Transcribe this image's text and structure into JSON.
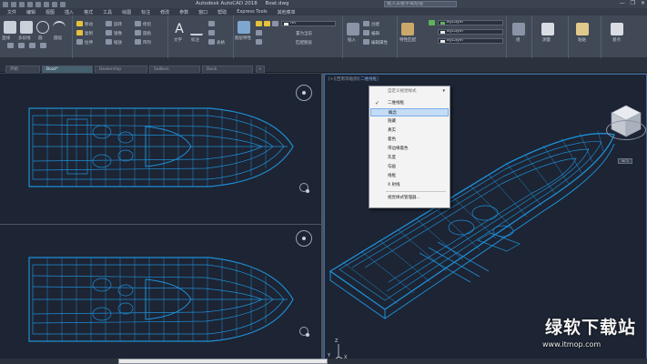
{
  "titlebar": {
    "app_title": "Autodesk AutoCAD 2018",
    "file_name": "Boat.dwg",
    "search_placeholder": "键入关键字或短语",
    "win_minimize": "—",
    "win_maximize": "❐",
    "win_close": "✕"
  },
  "menubar": [
    "文件",
    "编辑",
    "视图",
    "插入",
    "格式",
    "工具",
    "绘图",
    "标注",
    "修改",
    "参数",
    "窗口",
    "帮助",
    "Express Tools",
    "其他菜单"
  ],
  "ribbon": {
    "groups": [
      {
        "label": "绘图"
      },
      {
        "label": "修改"
      },
      {
        "label": "注释"
      },
      {
        "label": "图层"
      },
      {
        "label": "块"
      },
      {
        "label": "特性"
      },
      {
        "label": "组"
      },
      {
        "label": "实用工具"
      },
      {
        "label": "剪贴板"
      },
      {
        "label": "视图"
      }
    ],
    "tools": {
      "line": "直线",
      "polyline": "多段线",
      "circle": "圆",
      "arc": "圆弧",
      "move": "移动",
      "rotate": "旋转",
      "trim": "修剪",
      "copy": "复制",
      "mirror": "镜像",
      "fillet": "圆角",
      "stretch": "拉伸",
      "scale": "缩放",
      "array": "阵列",
      "text": "文字",
      "dimension": "标注",
      "table": "表格",
      "layer_properties": "图层特性",
      "make_current": "置为当前",
      "match_layer": "匹配图层",
      "insert": "插入",
      "create": "创建",
      "edit": "编辑",
      "edit_attributes": "编辑属性",
      "match_properties": "特性匹配",
      "group": "组",
      "measure": "测量",
      "paste": "粘贴",
      "base": "基点"
    },
    "layer_combo": "AR",
    "color_combo": "ByLayer",
    "linetype_combo": "ByLayer",
    "lineweight_combo": "ByLayer"
  },
  "doc_tabs": [
    "开始",
    "Boat*",
    "Dealership",
    "Sallbon",
    "Dock"
  ],
  "viewports": {
    "right_label_prefix": "[+][西南等轴测][",
    "right_label_style": "二维线框",
    "right_label_suffix": "]"
  },
  "context_menu": {
    "header": "自定义视觉样式",
    "items": [
      {
        "label": "二维线框",
        "checked": true
      },
      {
        "label": "概念",
        "highlighted": true
      },
      {
        "label": "隐藏"
      },
      {
        "label": "真实"
      },
      {
        "label": "着色"
      },
      {
        "label": "带边缘着色"
      },
      {
        "label": "灰度"
      },
      {
        "label": "勾画"
      },
      {
        "label": "线框"
      },
      {
        "label": "X 射线"
      },
      {
        "label": "视觉样式管理器..."
      }
    ]
  },
  "viewcube": {
    "nav_label": "WCS"
  },
  "ucs": {
    "x": "X",
    "y": "Y",
    "z": "Z"
  },
  "watermark": {
    "text": "绿软下载站",
    "url": "www.itmop.com"
  },
  "colors": {
    "wireframe": "#1e8fd6",
    "background": "#1d2433",
    "highlight": "#c5dcf5"
  }
}
